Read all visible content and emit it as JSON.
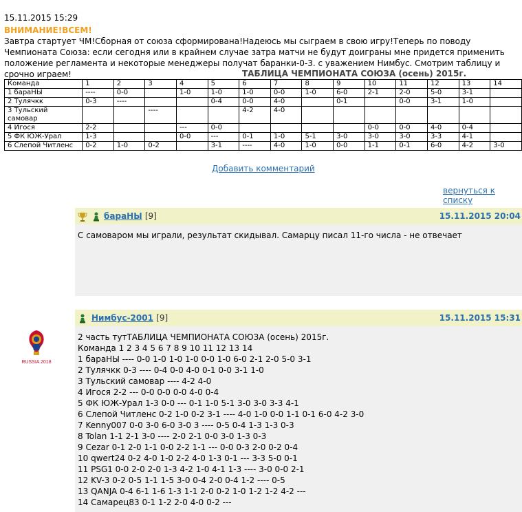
{
  "post": {
    "date": "15.11.2015 15:29",
    "alert": "ВНИМАНИЕ!ВСЕМ!",
    "text": " Завтра стартует ЧМ!Сборная от союза сформирована!Надеюсь мы сыграем в свою игру!Теперь по поводу Чемпионата Союза: если сегодня или в крайнем случае затра матчи не будут доиграны мне придется применить положение регламента и некоторые менеджеры получат баранки-0-3. с уважением Нимбус. Смотрим таблицу и срочно играем!",
    "table_title": "ТАБЛИЦА ЧЕМПИОНАТА СОЮЗА (осень) 2015г."
  },
  "table": {
    "header": [
      "Команда",
      "1",
      "2",
      "3",
      "4",
      "5",
      "6",
      "7",
      "8",
      "9",
      "10",
      "11",
      "12",
      "13",
      "14"
    ],
    "rows": [
      [
        "1  бараНЫ",
        "----",
        "0-0",
        "",
        "1-0",
        "1-0",
        "1-0",
        "0-0",
        "1-0",
        "6-0",
        "2-1",
        "2-0",
        "5-0",
        "3-1",
        ""
      ],
      [
        "2 Тулячкк",
        "0-3",
        "----",
        "",
        "",
        "0-4",
        "0-0",
        "4-0",
        "",
        "0-1",
        "",
        "0-0",
        "3-1",
        "1-0",
        ""
      ],
      [
        "3 Тульский самовар",
        "",
        "",
        "----",
        "",
        "",
        "4-2",
        "4-0",
        "",
        "",
        "",
        "",
        "",
        "",
        ""
      ],
      [
        "4 Игося",
        " 2-2",
        "",
        "",
        "---",
        "0-0",
        "",
        "",
        "",
        "",
        "0-0",
        "0-0",
        "4-0",
        "0-4",
        ""
      ],
      [
        "5 ФК ЮЖ-Урал",
        "1-3",
        "",
        "",
        "0-0",
        "---",
        "0-1",
        "1-0",
        "5-1",
        "3-0",
        "3-0",
        "3-0",
        "3-3",
        "4-1",
        ""
      ],
      [
        "6 Слепой Читленс",
        "0-2",
        "1-0",
        "0-2",
        "",
        "3-1",
        "----",
        "4-0",
        "1-0",
        "0-0",
        "1-1",
        "0-1",
        "6-0",
        "4-2",
        "3-0"
      ]
    ]
  },
  "links": {
    "add_comment": "Добавить комментарий",
    "back": "вернуться к списку"
  },
  "comments": [
    {
      "author": "бараНЫ",
      "rating": "[9]",
      "date": "15.11.2015 20:04",
      "lines": [
        "С самоваром мы играли, результат скидывал. Самарцу писал 11-го числа - не отвечает"
      ]
    },
    {
      "author": "Нимбус-2001",
      "rating": "[9]",
      "date": "15.11.2015 15:31",
      "logo_text": "RUSSIA 2018",
      "lines": [
        "2 часть тутТАБЛИЦА ЧЕМПИОНАТА СОЮЗА (осень) 2015г.",
        "Команда 1 2 3 4 5 6 7 8 9 10 11 12 13 14",
        "1 бараНЫ ---- 0-0 1-0 1-0 1-0 0-0 1-0 6-0 2-1 2-0 5-0 3-1",
        "2 Тулячкк 0-3 ---- 0-4 0-0 4-0 0-1 0-0 3-1 1-0",
        "3 Тульский самовар ---- 4-2 4-0",
        "4 Игося 2-2 --- 0-0 0-0 0-0 4-0 0-4",
        "5 ФК ЮЖ-Урал 1-3 0-0 --- 0-1 1-0 5-1 3-0 3-0 3-3 4-1",
        "6 Слепой Читленс 0-2 1-0 0-2 3-1 ---- 4-0 1-0 0-0 1-1 0-1 6-0 4-2 3-0",
        "7 Kenny007 0-0 3-0 6-0 3-0 3 ---- 0-5 0-4 1-3 1-3 0-3",
        "8 Tolan 1-1 2-1 3-0 ---- 2-0 2-1 0-0 3-0 1-3 0-3",
        "9 Cezar 0-1 2-0 1-1 0-0 2-2 1-1 --- 0-0 0-3 2-0 0-2 0-4",
        "10 qwert24 0-2 4-0 1-0 2-2 4-0 1-3 0-1 --- 3-3 5-0 0-1",
        "11 PSG1 0-0 2-0 2-0 1-3 4-2 1-0 4-1 1-3 ---- 3-0 0-0 2-1",
        "12 KV-3 0-2 0-5 1-1 1-5 3-0 0-4 2-0 0-4 1-2 ---- 0-5",
        "13 QANJA 0-4 6-1 1-6 1-3 1-1 2-0 0-2 1-0 1-2 1-2 4-2 ---",
        "14 Самарец83 0-1 1-2 2-0 4-0 0-2 ---"
      ]
    }
  ],
  "colors": {
    "alert": "#f0a020",
    "link": "#2a6fb0",
    "comment_header": "#f2f2c8",
    "comment_body": "#f0f0f0"
  },
  "icons": [
    "trophy-icon",
    "pawn-icon",
    "fifa-2018-logo"
  ]
}
